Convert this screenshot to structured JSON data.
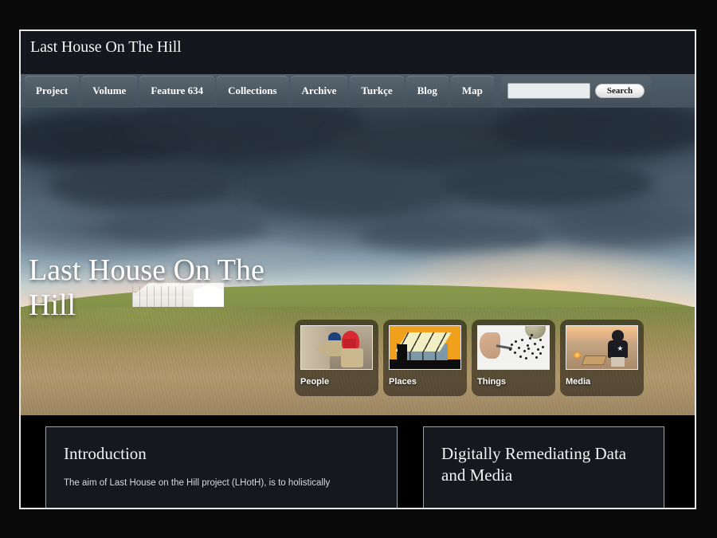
{
  "site": {
    "title": "Last House On The Hill"
  },
  "nav": {
    "items": [
      {
        "label": "Project"
      },
      {
        "label": "Volume"
      },
      {
        "label": "Feature 634"
      },
      {
        "label": "Collections"
      },
      {
        "label": "Archive"
      },
      {
        "label": "Turkçe"
      },
      {
        "label": "Blog"
      },
      {
        "label": "Map"
      }
    ]
  },
  "search": {
    "value": "",
    "placeholder": "",
    "button_label": "Search"
  },
  "hero": {
    "headline": "Last House On The Hill",
    "image_description": "Stormy dark clouds over a grassy hill with a white excavation shelter tent"
  },
  "cards": [
    {
      "label": "People",
      "icon": "people-excavating-thumbnail"
    },
    {
      "label": "Places",
      "icon": "shelter-illustration-thumbnail"
    },
    {
      "label": "Things",
      "icon": "artifact-sorting-thumbnail"
    },
    {
      "label": "Media",
      "icon": "virtual-world-avatar-thumbnail"
    }
  ],
  "panels": {
    "intro": {
      "title": "Introduction",
      "body": "The aim of Last House on the Hill project (LHotH), is to holistically"
    },
    "remediating": {
      "title": "Digitally Remediating Data and Media",
      "body": ""
    }
  },
  "colors": {
    "header_bg": "#14171d",
    "nav_bg": "#4a5663",
    "panel_bg": "#15191e",
    "panel_border": "#9ba4ad",
    "page_border": "#e8e8e8",
    "backdrop": "#0a0a0a"
  }
}
